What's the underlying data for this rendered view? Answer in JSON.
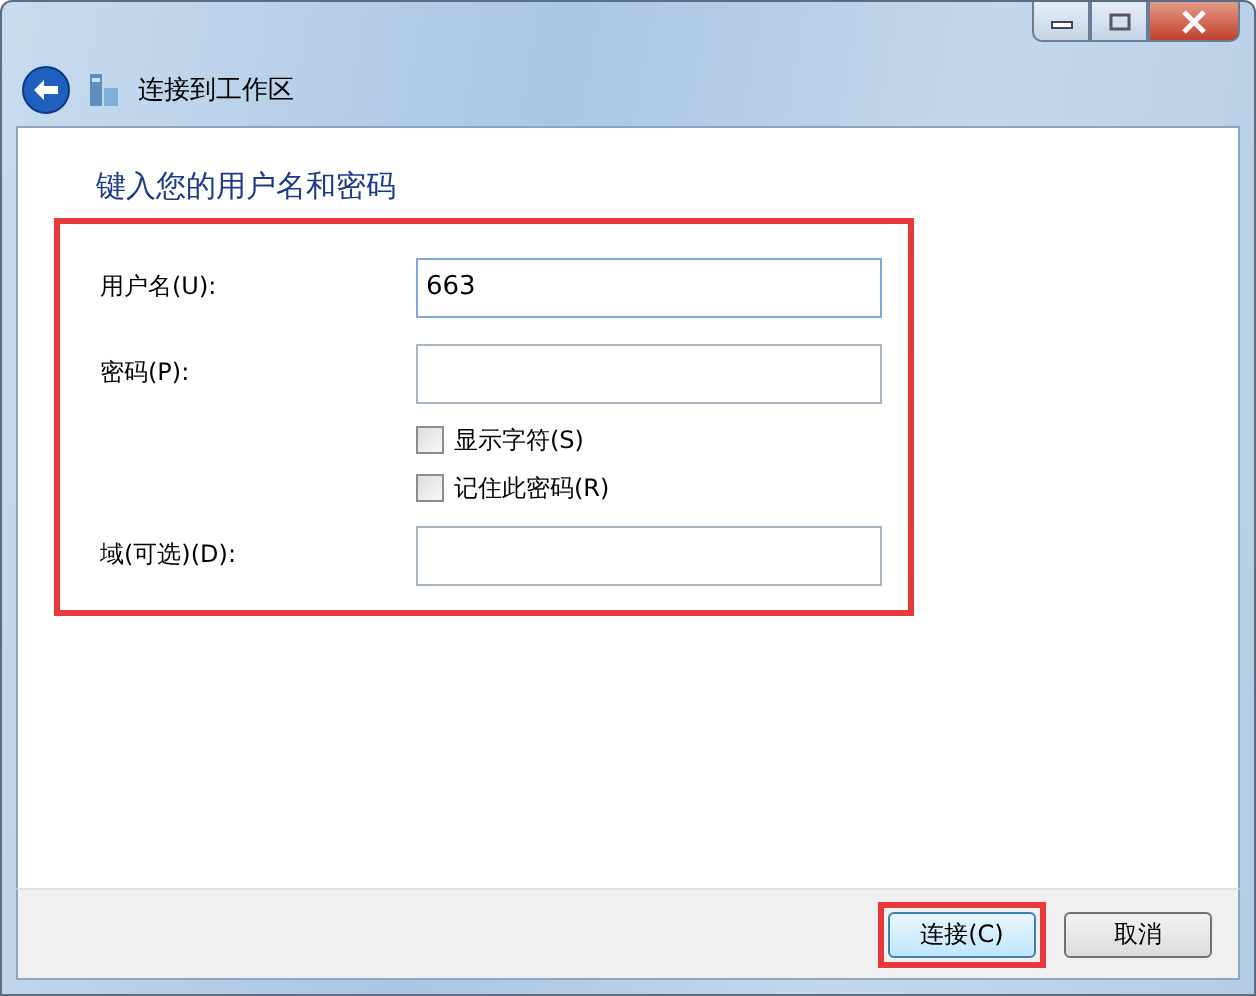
{
  "window": {
    "title": "连接到工作区"
  },
  "heading": "键入您的用户名和密码",
  "form": {
    "highlighted": true,
    "fields": [
      {
        "kind": "input",
        "label": "用户名(U):",
        "value": "663",
        "focused": true
      },
      {
        "kind": "input",
        "label": "密码(P):",
        "focused": false
      },
      {
        "kind": "checkbox",
        "label": "显示字符(S)",
        "checked": false
      },
      {
        "kind": "checkbox",
        "label": "记住此密码(R)",
        "checked": false
      },
      {
        "kind": "input",
        "label": "域(可选)(D):",
        "focused": false
      }
    ]
  },
  "buttons": [
    {
      "label": "连接(C)",
      "highlighted": true,
      "default": true
    },
    {
      "label": "取消",
      "highlighted": false,
      "default": false
    }
  ]
}
